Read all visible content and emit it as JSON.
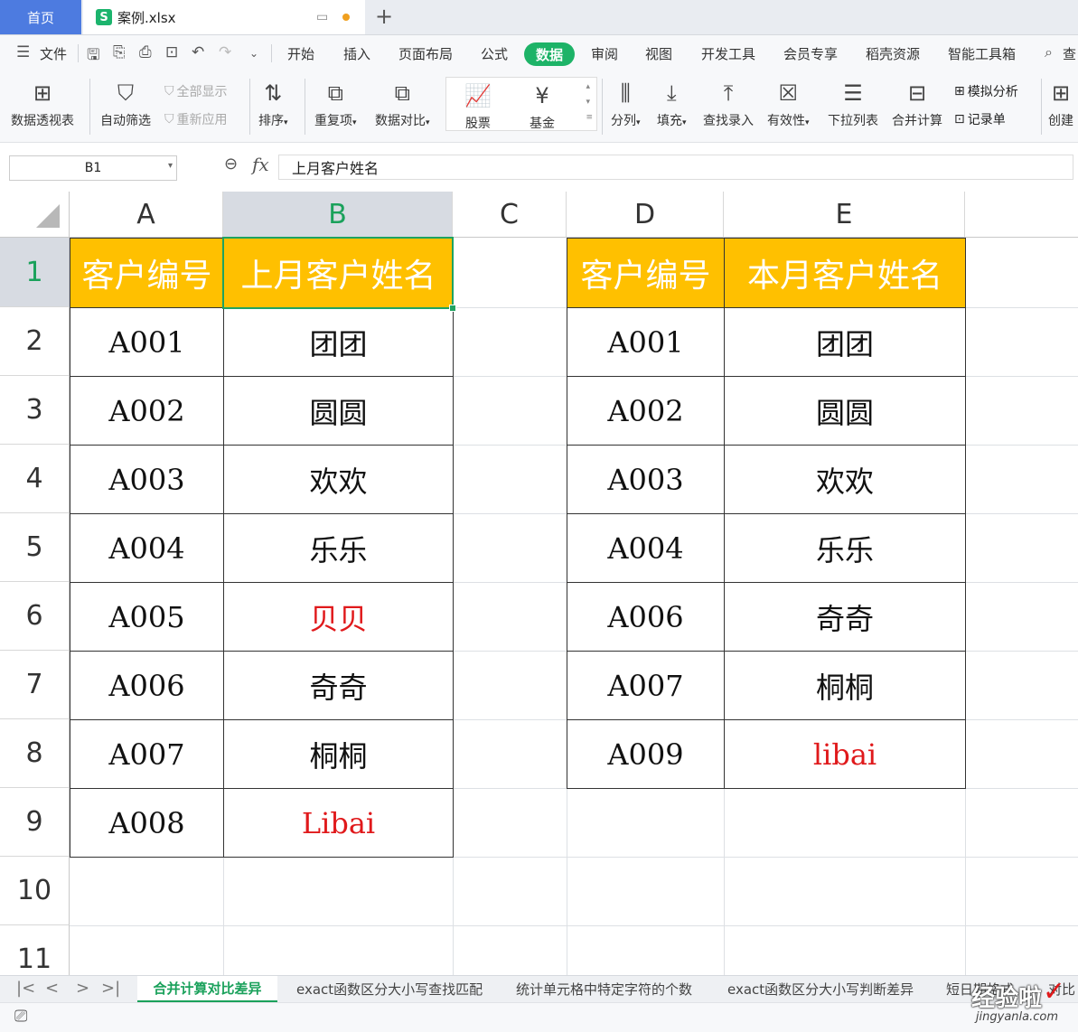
{
  "tabs": {
    "home": "首页",
    "file": "案例.xlsx"
  },
  "menu": {
    "items": [
      "文件",
      "开始",
      "插入",
      "页面布局",
      "公式",
      "数据",
      "审阅",
      "视图",
      "开发工具",
      "会员专享",
      "稻壳资源",
      "智能工具箱"
    ],
    "active": "数据",
    "search_partial": "查"
  },
  "ribbon": {
    "pivot": "数据透视表",
    "autofilter": "自动筛选",
    "show_all": "全部显示",
    "reapply": "重新应用",
    "sort": "排序",
    "duplicates": "重复项",
    "compare": "数据对比",
    "stock": "股票",
    "fund": "基金",
    "split": "分列",
    "fill": "填充",
    "lookup_entry": "查找录入",
    "validity": "有效性",
    "dropdown": "下拉列表",
    "consolidate": "合并计算",
    "simulate": "模拟分析",
    "record": "记录单",
    "create_partial": "创建"
  },
  "formula_bar": {
    "name_box": "B1",
    "fx": "fx",
    "content": "上月客户姓名"
  },
  "sheet": {
    "columns": [
      "A",
      "B",
      "C",
      "D",
      "E"
    ],
    "selected_column": "B",
    "rows": [
      "1",
      "2",
      "3",
      "4",
      "5",
      "6",
      "7",
      "8",
      "9",
      "10",
      "11"
    ],
    "selected_row": "1",
    "left_table": {
      "headers": [
        "客户编号",
        "上月客户姓名"
      ],
      "rows": [
        [
          "A001",
          "团团"
        ],
        [
          "A002",
          "圆圆"
        ],
        [
          "A003",
          "欢欢"
        ],
        [
          "A004",
          "乐乐"
        ],
        [
          "A005",
          "贝贝"
        ],
        [
          "A006",
          "奇奇"
        ],
        [
          "A007",
          "桐桐"
        ],
        [
          "A008",
          "Libai"
        ]
      ],
      "highlight_color": "#e0191b"
    },
    "right_table": {
      "headers": [
        "客户编号",
        "本月客户姓名"
      ],
      "rows": [
        [
          "A001",
          "团团"
        ],
        [
          "A002",
          "圆圆"
        ],
        [
          "A003",
          "欢欢"
        ],
        [
          "A004",
          "乐乐"
        ],
        [
          "A006",
          "奇奇"
        ],
        [
          "A007",
          "桐桐"
        ],
        [
          "A009",
          "libai"
        ]
      ]
    },
    "header_fill": "#ffc000"
  },
  "sheet_tabs": [
    "合并计算对比差异",
    "exact函数区分大小写查找匹配",
    "统计单元格中特定字符的个数",
    "exact函数区分大小写判断差异",
    "短日期格式",
    "对比"
  ],
  "active_sheet_tab": "合并计算对比差异",
  "watermark": {
    "text": "经验啦",
    "url": "jingyanla.com"
  }
}
